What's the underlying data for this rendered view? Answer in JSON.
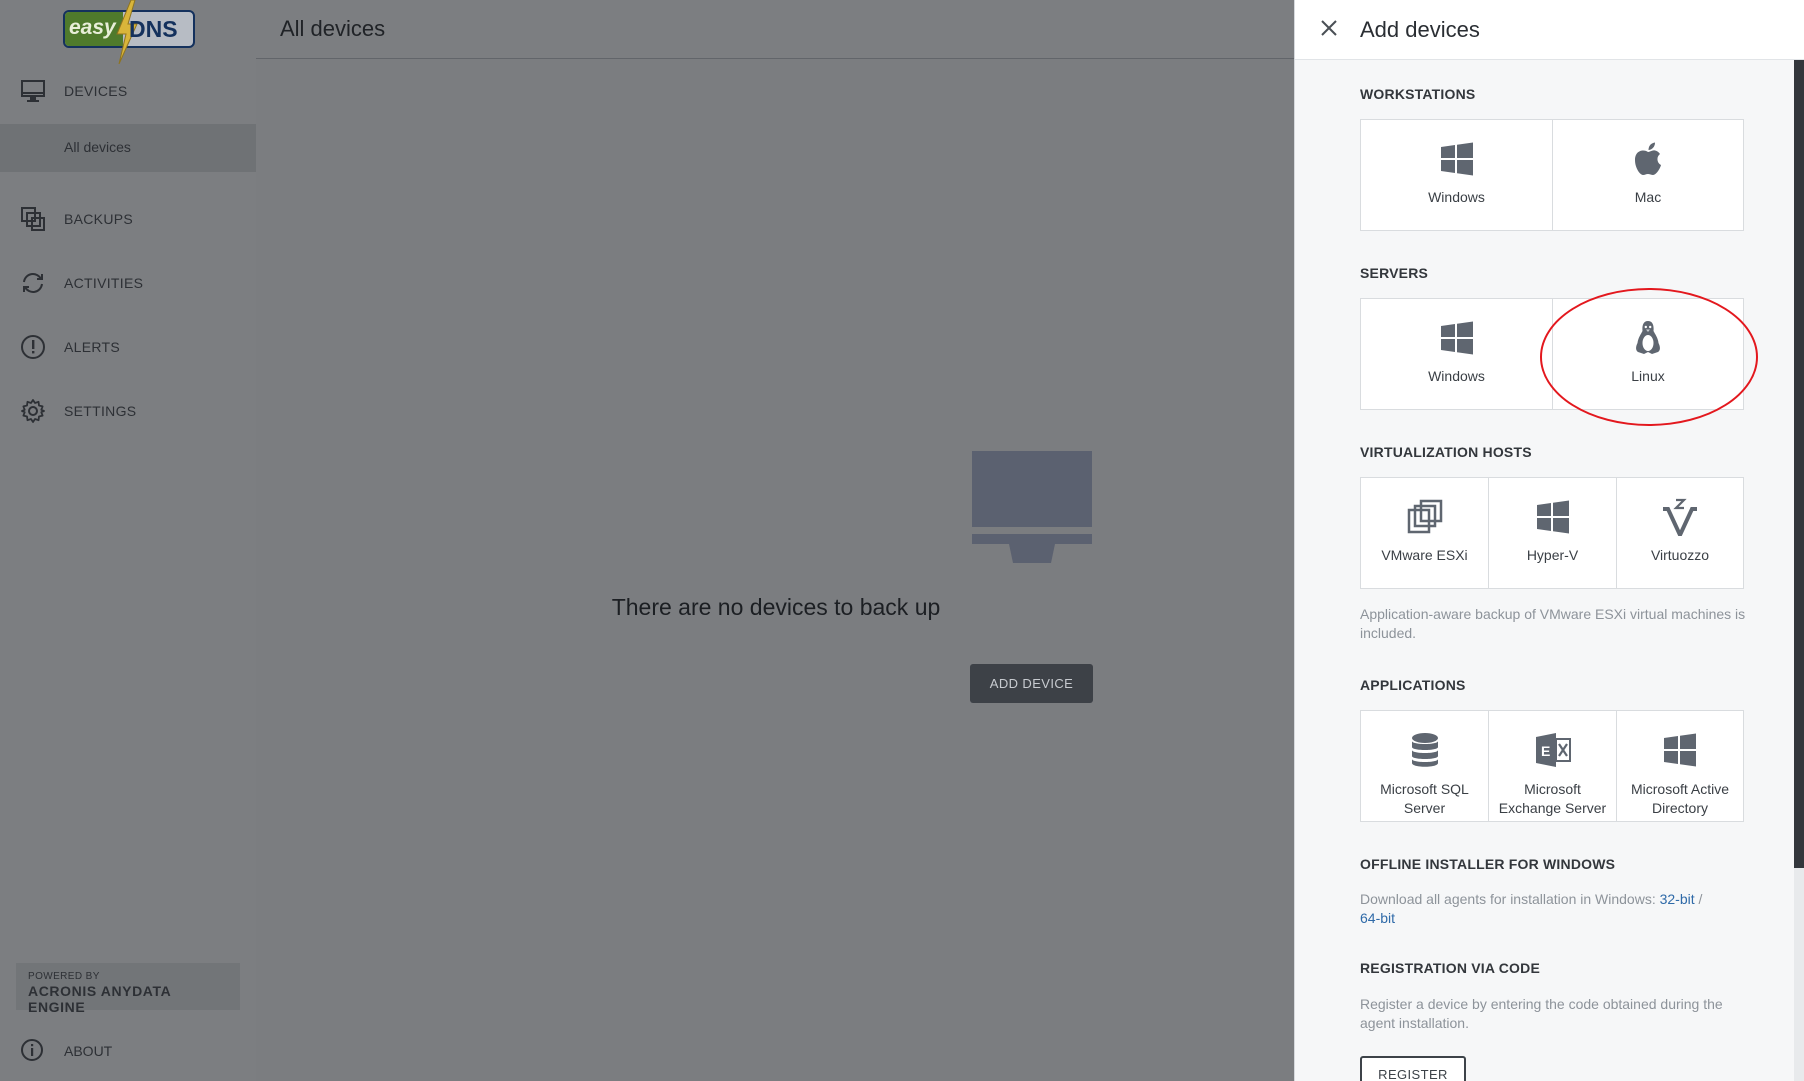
{
  "brand": {
    "logo_left": "easy",
    "logo_right": "DNS"
  },
  "sidebar": {
    "items": [
      {
        "label": "DEVICES",
        "icon": "monitor-icon"
      },
      {
        "label": "BACKUPS",
        "icon": "copies-icon"
      },
      {
        "label": "ACTIVITIES",
        "icon": "sync-icon"
      },
      {
        "label": "ALERTS",
        "icon": "alert-icon"
      },
      {
        "label": "SETTINGS",
        "icon": "gear-icon"
      }
    ],
    "sub_item": "All devices",
    "powered_by": "POWERED BY",
    "engine": "ACRONIS ANYDATA ENGINE",
    "about": "ABOUT"
  },
  "main": {
    "title": "All devices",
    "empty_message": "There are no devices to back up",
    "add_button": "ADD DEVICE"
  },
  "panel": {
    "title": "Add devices",
    "workstations": {
      "title": "WORKSTATIONS",
      "tiles": [
        {
          "label": "Windows",
          "icon": "windows-icon"
        },
        {
          "label": "Mac",
          "icon": "apple-icon"
        }
      ]
    },
    "servers": {
      "title": "SERVERS",
      "tiles": [
        {
          "label": "Windows",
          "icon": "windows-icon"
        },
        {
          "label": "Linux",
          "icon": "linux-icon"
        }
      ]
    },
    "virtualization": {
      "title": "VIRTUALIZATION HOSTS",
      "tiles": [
        {
          "label": "VMware ESXi",
          "icon": "vmware-icon"
        },
        {
          "label": "Hyper-V",
          "icon": "windows-icon"
        },
        {
          "label": "Virtuozzo",
          "icon": "virtuozzo-icon"
        }
      ],
      "note": "Application-aware backup of VMware ESXi virtual machines is included."
    },
    "applications": {
      "title": "APPLICATIONS",
      "tiles": [
        {
          "label_1": "Microsoft SQL",
          "label_2": "Server",
          "icon": "database-icon"
        },
        {
          "label_1": "Microsoft",
          "label_2": "Exchange Server",
          "icon": "exchange-icon"
        },
        {
          "label_1": "Microsoft Active",
          "label_2": "Directory",
          "icon": "windows-icon"
        }
      ]
    },
    "offline": {
      "title": "OFFLINE INSTALLER FOR WINDOWS",
      "note": "Download all agents for installation in Windows: ",
      "link_32": "32-bit",
      "separator": " /",
      "link_64": "64-bit"
    },
    "registration": {
      "title": "REGISTRATION VIA CODE",
      "note": "Register a device by entering the code obtained during the agent installation.",
      "button": "REGISTER"
    }
  },
  "colors": {
    "accent": "#2f6aa8",
    "highlight": "#e3181e",
    "panel_bg": "#f6f7f8"
  }
}
